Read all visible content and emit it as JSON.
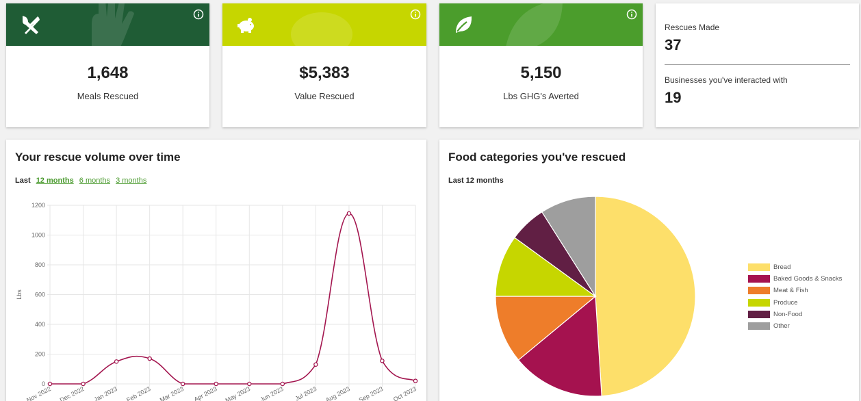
{
  "stats": [
    {
      "value": "1,648",
      "label": "Meals Rescued",
      "color": "#1f5c35",
      "icon": "fork-knife-icon"
    },
    {
      "value": "$5,383",
      "label": "Value Rescued",
      "color": "#c6d600",
      "icon": "piggy-bank-icon"
    },
    {
      "value": "5,150",
      "label": "Lbs GHG's Averted",
      "color": "#4b9d2c",
      "icon": "leaf-icon"
    }
  ],
  "summary": {
    "rescues_label": "Rescues Made",
    "rescues_value": "37",
    "businesses_label": "Businesses you've interacted with",
    "businesses_value": "19"
  },
  "volume": {
    "title": "Your rescue volume over time",
    "range_prefix": "Last",
    "ranges": [
      "12 months",
      "6 months",
      "3 months"
    ],
    "active_range": "12 months",
    "line_color": "#a3164f"
  },
  "categories": {
    "title": "Food categories you've rescued",
    "subtitle": "Last 12 months"
  },
  "chart_data": [
    {
      "type": "line",
      "x": [
        "Nov 2022",
        "Dec 2022",
        "Jan 2023",
        "Feb 2023",
        "Mar 2023",
        "Apr 2023",
        "May 2023",
        "Jun 2023",
        "Jul 2023",
        "Aug 2023",
        "Sep 2023",
        "Oct 2023"
      ],
      "series": [
        {
          "values": [
            0,
            0,
            150,
            170,
            0,
            0,
            0,
            0,
            130,
            1145,
            155,
            20
          ]
        }
      ],
      "ylabel": "Lbs",
      "ylim": [
        0,
        1200
      ],
      "yticks": [
        "0",
        "200",
        "400",
        "600",
        "800",
        "1000",
        "1200"
      ],
      "grid": true
    },
    {
      "type": "pie",
      "labels": [
        "Bread",
        "Baked Goods & Snacks",
        "Meat & Fish",
        "Produce",
        "Non-Food",
        "Other"
      ],
      "values": [
        49,
        15,
        11,
        10,
        6,
        9
      ],
      "colors": [
        "#fddf6a",
        "#a5124f",
        "#ee7d2a",
        "#c6d600",
        "#611f44",
        "#9e9e9e"
      ],
      "legend": "right"
    }
  ]
}
